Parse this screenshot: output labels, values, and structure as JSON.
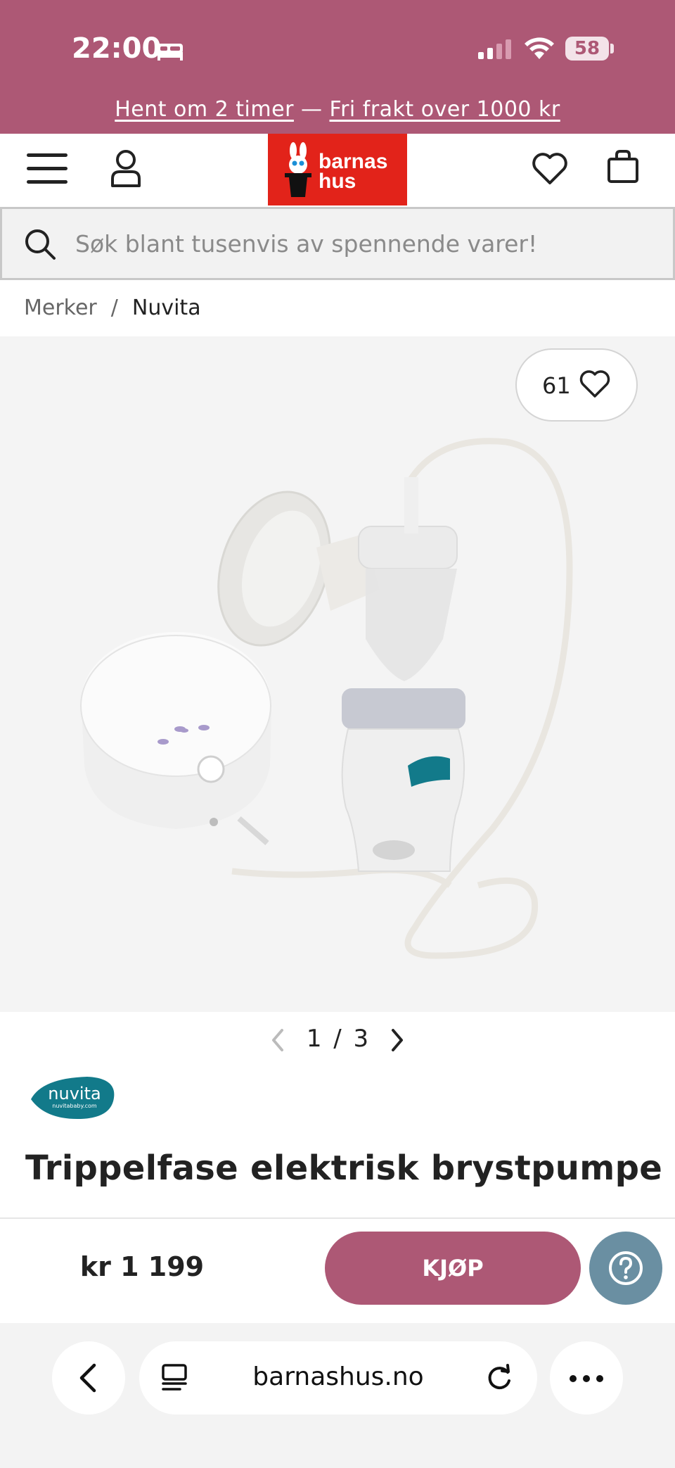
{
  "status_bar": {
    "time": "22:00",
    "battery": "58"
  },
  "promo": {
    "pickup_link": "Hent om 2 timer",
    "separator": "—",
    "shipping_link": "Fri frakt over 1000 kr"
  },
  "header": {
    "logo_line1": "barnas",
    "logo_line2": "hus",
    "brand_color": "#e2231a"
  },
  "search": {
    "placeholder": "Søk blant tusenvis av spennende varer!"
  },
  "breadcrumb": {
    "items": [
      "Merker",
      "Nuvita"
    ],
    "separator": "/"
  },
  "gallery": {
    "likes": "61",
    "current": "1",
    "separator": "/",
    "total": "3"
  },
  "product": {
    "brand_logo": "nuvita",
    "brand_sub": "nuvitababy.com",
    "title": "Trippelfase elektrisk brystpumpe",
    "price": "kr 1 199",
    "buy_label": "KJØP"
  },
  "browser": {
    "url": "barnashus.no"
  },
  "colors": {
    "accent": "#ad5875",
    "help": "#6a8fa2"
  }
}
